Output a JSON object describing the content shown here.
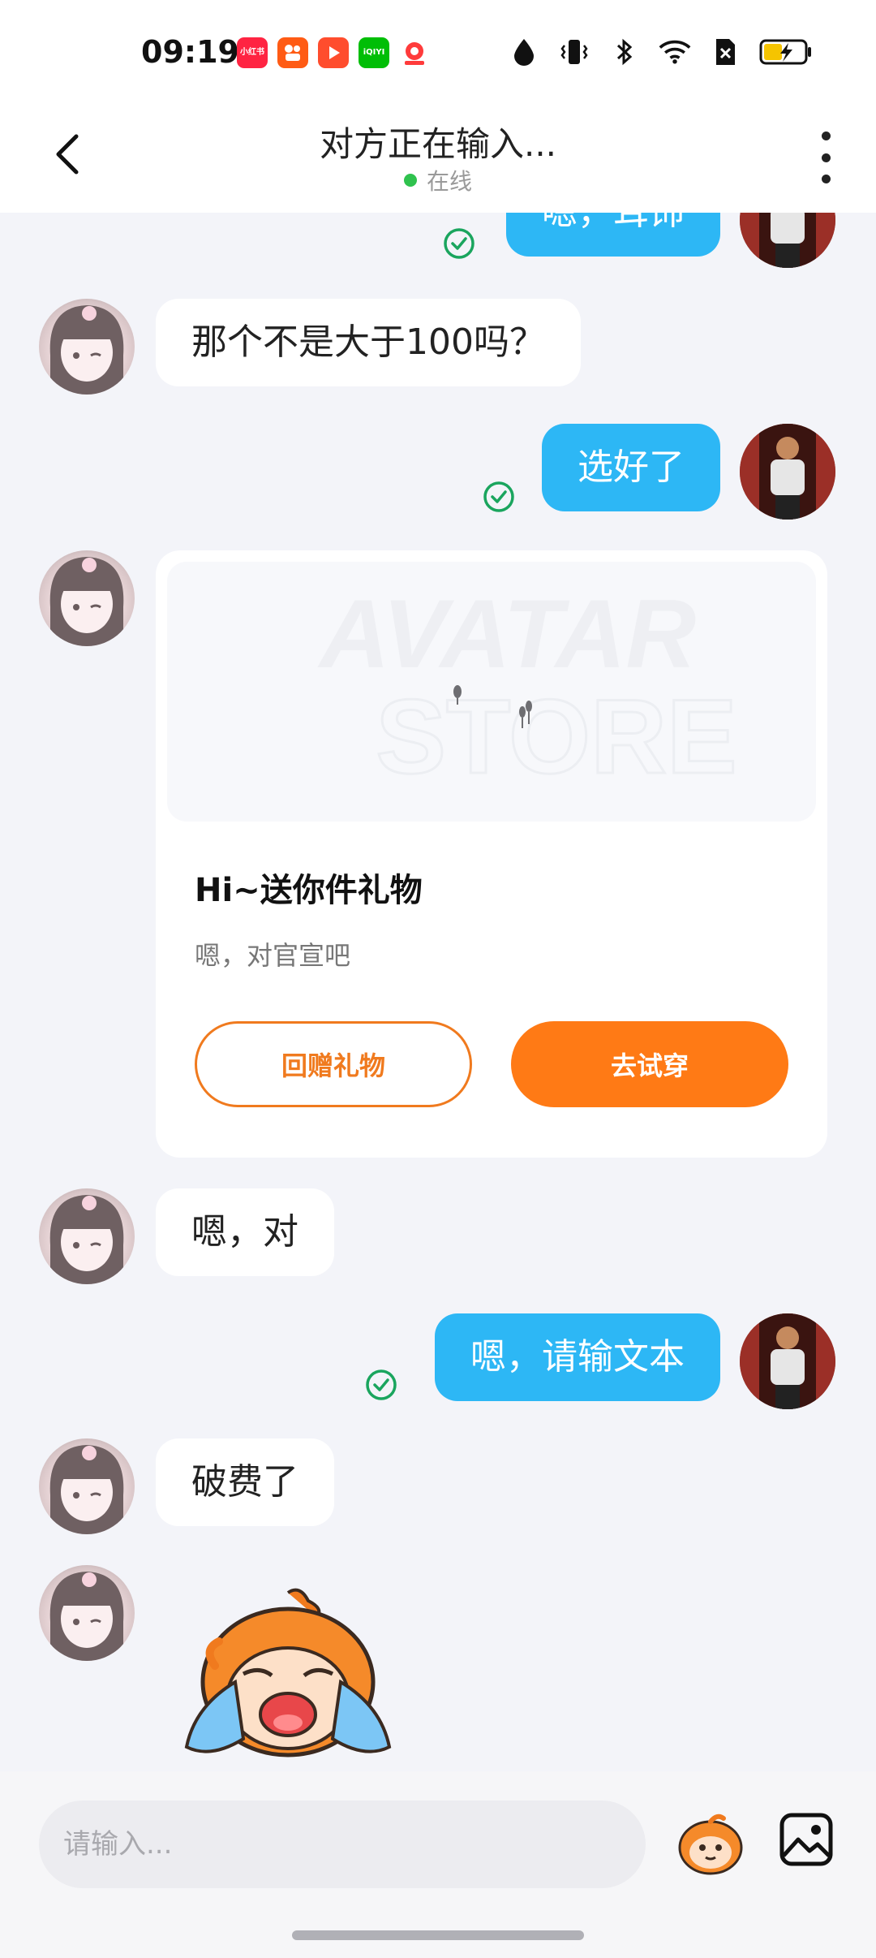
{
  "status_bar": {
    "time": "09:19",
    "apps": [
      {
        "name": "xiaohongshu-icon",
        "label": "小红书",
        "color": "#ff2442"
      },
      {
        "name": "kuaishou-icon",
        "label": "",
        "color": "#ff5b14"
      },
      {
        "name": "video-app-icon",
        "label": "",
        "color": "#ff4d2d"
      },
      {
        "name": "iqiyi-icon",
        "label": "iQIYI",
        "color": "#00be06"
      },
      {
        "name": "music-app-icon",
        "label": "",
        "color": "#ff3b3b"
      }
    ],
    "battery_color": "#f5c400"
  },
  "header": {
    "title": "对方正在输入...",
    "online_text": "在线",
    "online_color": "#2fc24e"
  },
  "messages": [
    {
      "side": "right",
      "text": "嗯，耳饰"
    },
    {
      "side": "left",
      "text": "那个不是大于100吗？"
    },
    {
      "side": "right",
      "text": "选好了"
    },
    {
      "side": "left",
      "type": "gift-card"
    },
    {
      "side": "left",
      "text": "嗯，对"
    },
    {
      "side": "right",
      "text": "嗯，请输文本"
    },
    {
      "side": "left",
      "text": "破费了"
    },
    {
      "side": "left",
      "type": "sticker",
      "sticker": "crying-mascot"
    }
  ],
  "gift_card": {
    "watermark_line1": "AVATAR",
    "watermark_line2": "STORE",
    "title": "Hi~送你件礼物",
    "subtitle": "嗯，对官宣吧",
    "return_gift_label": "回赠礼物",
    "try_on_label": "去试穿",
    "accent_color": "#ff7a15"
  },
  "input": {
    "placeholder": "请输入..."
  },
  "colors": {
    "outgoing_bubble": "#2db7f5",
    "incoming_bubble": "#ffffff",
    "read_check": "#1aa55e"
  }
}
